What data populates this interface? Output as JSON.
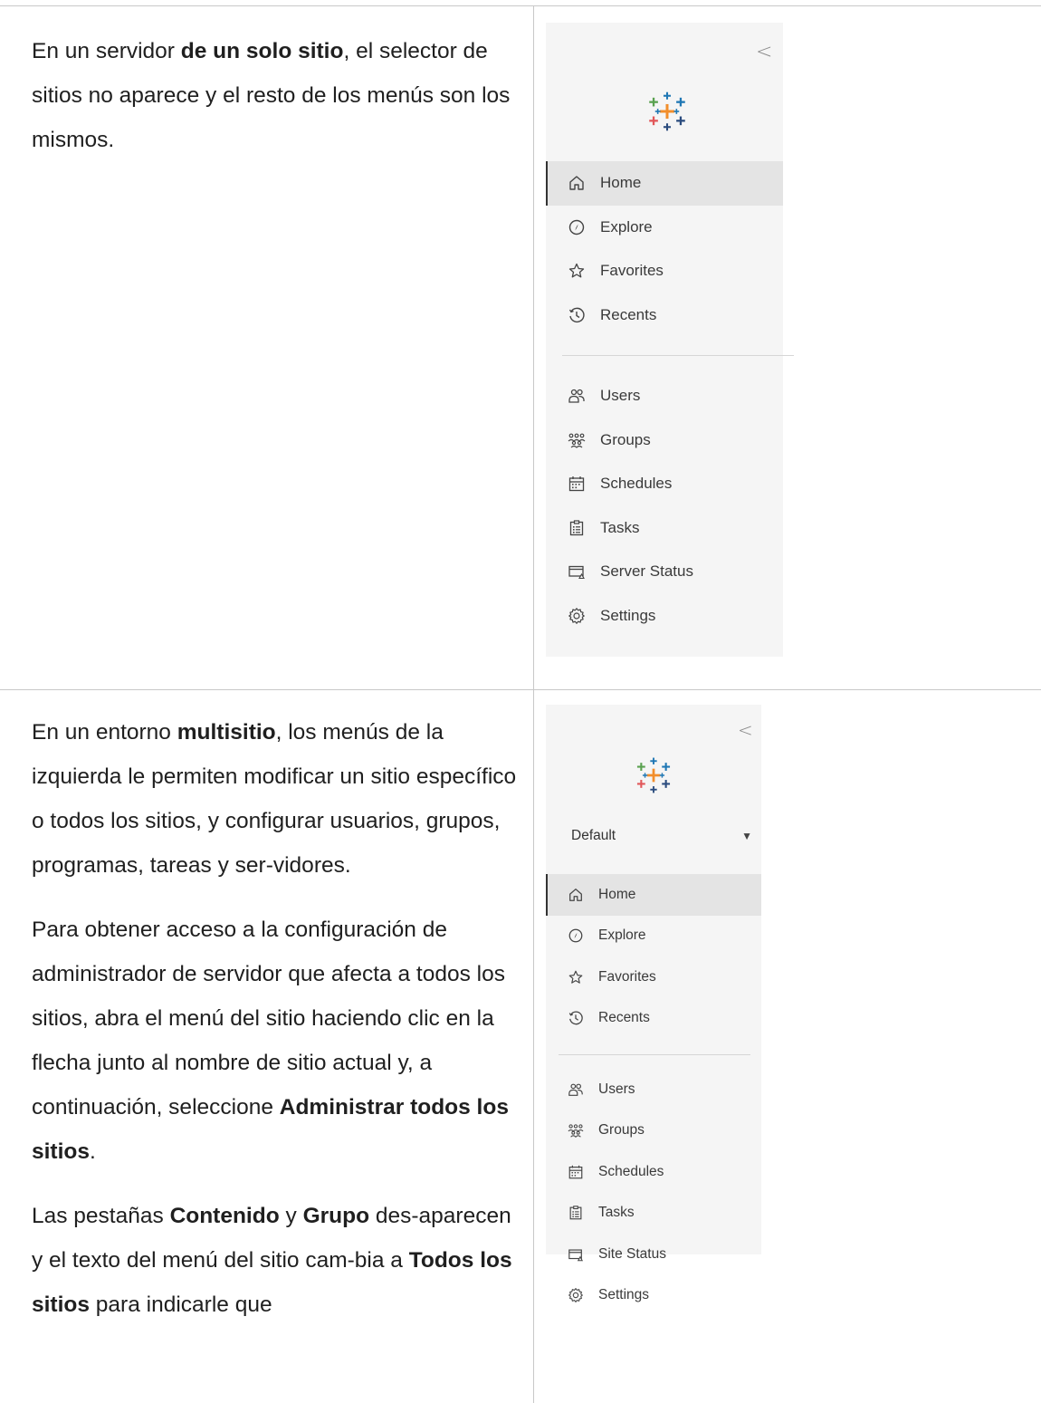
{
  "row1": {
    "text": {
      "p1": {
        "a": "En un servidor ",
        "b": "de un solo sitio",
        "c": ", el selector de sitios no aparece y el resto de los menús son los mismos."
      }
    },
    "panel": {
      "collapse_glyph": "<",
      "nav_primary": [
        {
          "label": "Home",
          "icon": "home-icon",
          "active": true
        },
        {
          "label": "Explore",
          "icon": "compass-icon"
        },
        {
          "label": "Favorites",
          "icon": "star-icon"
        },
        {
          "label": "Recents",
          "icon": "clock-icon"
        }
      ],
      "nav_admin": [
        {
          "label": "Users",
          "icon": "users-icon"
        },
        {
          "label": "Groups",
          "icon": "groups-icon"
        },
        {
          "label": "Schedules",
          "icon": "calendar-icon"
        },
        {
          "label": "Tasks",
          "icon": "tasks-icon"
        },
        {
          "label": "Server Status",
          "icon": "status-icon"
        },
        {
          "label": "Settings",
          "icon": "gear-icon"
        }
      ]
    }
  },
  "row2": {
    "text": {
      "p1": {
        "a": "En un entorno ",
        "b": "multisitio",
        "c": ", los menús de la izquierda le permiten modificar un sitio específico o todos los sitios, y configurar usuarios, grupos, programas, tareas y ser-vidores."
      },
      "p2": {
        "a": "Para obtener acceso a la configuración de administrador de servidor que afecta a todos los sitios, abra el menú del sitio haciendo clic en la flecha junto al nombre de sitio actual y, a continuación, seleccione ",
        "b": "Administrar todos los sitios",
        "c": "."
      },
      "p3": {
        "a": "Las pestañas ",
        "b": "Contenido",
        "c": " y ",
        "d": "Grupo",
        "e": " des-aparecen y el texto del menú del sitio cam-bia a ",
        "f": "Todos los sitios",
        "g": " para indicarle que"
      }
    },
    "panel": {
      "collapse_glyph": "<",
      "site_name": "Default",
      "site_caret": "▼",
      "nav_primary": [
        {
          "label": "Home",
          "icon": "home-icon",
          "active": true
        },
        {
          "label": "Explore",
          "icon": "compass-icon"
        },
        {
          "label": "Favorites",
          "icon": "star-icon"
        },
        {
          "label": "Recents",
          "icon": "clock-icon"
        }
      ],
      "nav_admin": [
        {
          "label": "Users",
          "icon": "users-icon"
        },
        {
          "label": "Groups",
          "icon": "groups-icon"
        },
        {
          "label": "Schedules",
          "icon": "calendar-icon"
        },
        {
          "label": "Tasks",
          "icon": "tasks-icon"
        },
        {
          "label": "Site Status",
          "icon": "status-icon"
        },
        {
          "label": "Settings",
          "icon": "gear-icon"
        }
      ]
    }
  },
  "colors": {
    "logo_blue": "#1f77b4",
    "logo_orange": "#f28e2b",
    "logo_red": "#e15759",
    "logo_teal": "#59a14f",
    "logo_navy": "#2b4c7e"
  }
}
